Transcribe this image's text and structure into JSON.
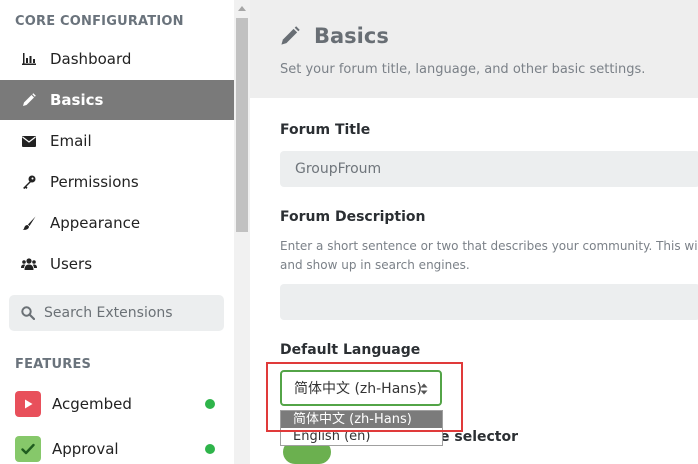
{
  "sidebar": {
    "core_title": "CORE CONFIGURATION",
    "items": [
      {
        "label": "Dashboard",
        "icon": "chart-bar-icon"
      },
      {
        "label": "Basics",
        "icon": "pencil-icon"
      },
      {
        "label": "Email",
        "icon": "envelope-icon"
      },
      {
        "label": "Permissions",
        "icon": "key-icon"
      },
      {
        "label": "Appearance",
        "icon": "paintbrush-icon"
      },
      {
        "label": "Users",
        "icon": "users-icon"
      }
    ],
    "active_index": 1,
    "search_placeholder": "Search Extensions",
    "features_title": "FEATURES",
    "extensions": [
      {
        "label": "Acgembed",
        "color": "#e8505b",
        "status_color": "#2eb44a"
      },
      {
        "label": "Approval",
        "color": "#86c86a",
        "status_color": "#2eb44a"
      }
    ]
  },
  "header": {
    "title": "Basics",
    "description": "Set your forum title, language, and other basic settings."
  },
  "form": {
    "forum_title_label": "Forum Title",
    "forum_title_value": "GroupFroum",
    "forum_description_label": "Forum Description",
    "forum_description_help_line1": "Enter a short sentence or two that describes your community. This will ap",
    "forum_description_help_line2": "and show up in search engines.",
    "forum_description_value": "",
    "default_language_label": "Default Language",
    "default_language_selected": "简体中文 (zh-Hans)",
    "language_options": [
      "简体中文 (zh-Hans)",
      "English (en)"
    ],
    "language_selector_label_partial": "e selector"
  },
  "colors": {
    "active_nav": "#7a7a7a",
    "accent_green": "#53a447",
    "highlight_red": "#e03a3a"
  }
}
